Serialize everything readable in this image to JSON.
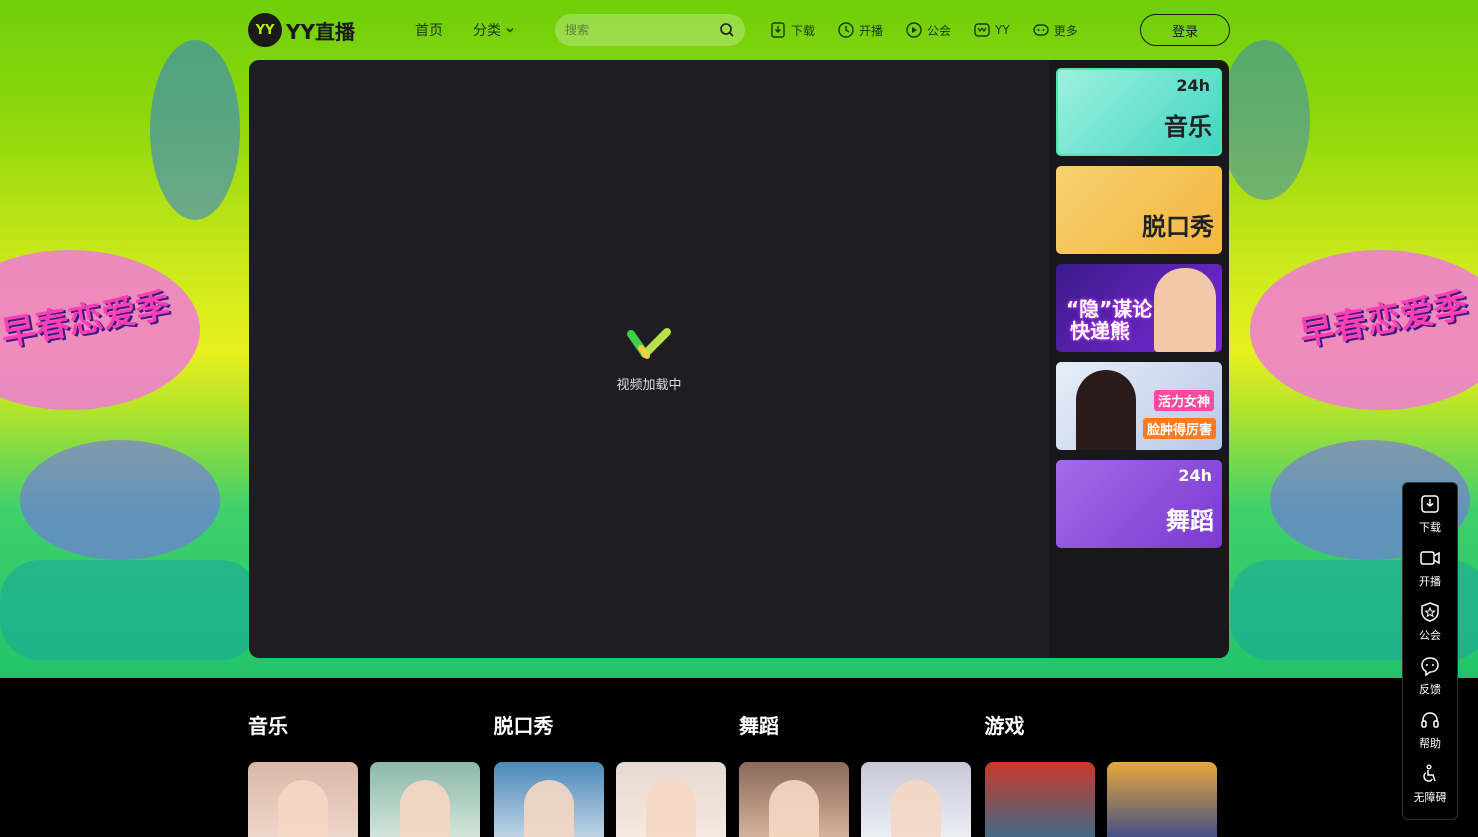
{
  "header": {
    "logo_mark": "YY",
    "logo_text": "YY直播",
    "nav": [
      {
        "label": "首页"
      },
      {
        "label": "分类"
      }
    ],
    "search_placeholder": "搜索",
    "tools": [
      {
        "label": "下载",
        "icon": "download-icon"
      },
      {
        "label": "开播",
        "icon": "broadcast-icon"
      },
      {
        "label": "公会",
        "icon": "guild-icon"
      },
      {
        "label": "YY",
        "icon": "yy-icon"
      },
      {
        "label": "更多",
        "icon": "more-icon"
      }
    ],
    "login_label": "登录"
  },
  "hero": {
    "deco_left": "早春恋爱季",
    "deco_right": "早春恋爱季"
  },
  "player": {
    "loading_text": "视频加载中",
    "banners": [
      {
        "label": "音乐",
        "badge": "24h"
      },
      {
        "label": "脱口秀"
      },
      {
        "line1": "“隐”谋论",
        "line2": "快递熊"
      },
      {
        "tag1": "活力女神",
        "tag2": "脸肿得厉害"
      },
      {
        "label": "舞蹈",
        "badge": "24h"
      }
    ]
  },
  "categories": [
    {
      "title": "音乐"
    },
    {
      "title": "脱口秀"
    },
    {
      "title": "舞蹈"
    },
    {
      "title": "游戏"
    }
  ],
  "float_bar": [
    {
      "label": "下载",
      "icon": "download-icon"
    },
    {
      "label": "开播",
      "icon": "camera-icon"
    },
    {
      "label": "公会",
      "icon": "shield-star-icon"
    },
    {
      "label": "反馈",
      "icon": "feedback-icon"
    },
    {
      "label": "帮助",
      "icon": "headset-icon"
    },
    {
      "label": "无障碍",
      "icon": "accessibility-icon"
    }
  ],
  "colors": {
    "accent": "#b7f000",
    "player_bg": "#1e1e22",
    "active_border": "#4fe6a8"
  }
}
